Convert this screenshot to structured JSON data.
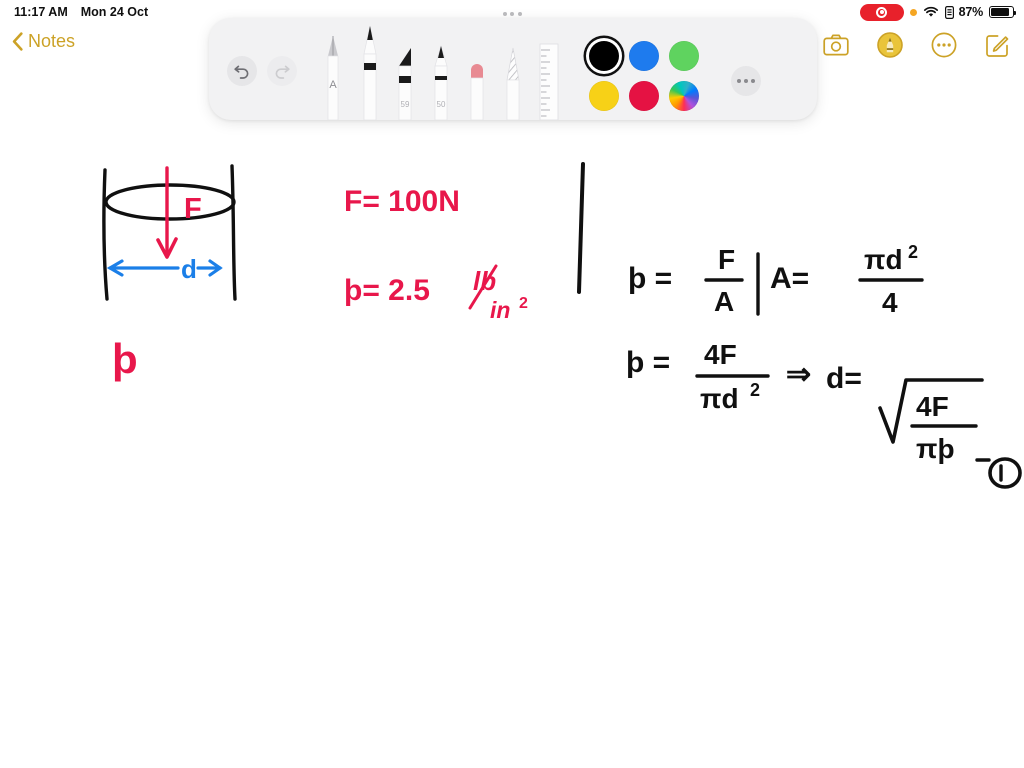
{
  "status_bar": {
    "time": "11:17 AM",
    "date": "Mon 24 Oct",
    "battery_percent": "87%",
    "icons": {
      "recording": "screen-recording-pill-icon",
      "orange_dot": "microphone-in-use-indicator-icon",
      "wifi": "wifi-icon",
      "lock": "orientation-lock-icon",
      "battery": "battery-icon"
    },
    "colors": {
      "recording_red": "#E8212B",
      "orange": "#F5A623",
      "text": "#101010"
    }
  },
  "navbar": {
    "back_label": "Notes",
    "back_icon": "chevron-left-icon",
    "accent_color": "#CCA227",
    "actions": [
      {
        "name": "camera-button",
        "icon": "camera-icon"
      },
      {
        "name": "markup-button",
        "icon": "markup-pen-circle-icon"
      },
      {
        "name": "more-options-button",
        "icon": "ellipsis-circle-icon"
      },
      {
        "name": "compose-button",
        "icon": "compose-square-pencil-icon"
      }
    ]
  },
  "tool_palette": {
    "handle": "drag-handle-icon",
    "undo": {
      "label": "Undo",
      "icon": "undo-arrow-icon",
      "enabled": true
    },
    "redo": {
      "label": "Redo",
      "icon": "redo-arrow-icon",
      "enabled": false
    },
    "tools": [
      {
        "name": "scribble-tool",
        "label": "A",
        "selected": false
      },
      {
        "name": "pen-tool",
        "label": "",
        "selected": true
      },
      {
        "name": "highlighter-tool",
        "label": "59",
        "selected": false
      },
      {
        "name": "marker-tool",
        "label": "50",
        "selected": false
      },
      {
        "name": "eraser-tool",
        "label": "",
        "selected": false
      },
      {
        "name": "lasso-select-tool",
        "label": "",
        "selected": false
      },
      {
        "name": "ruler-tool",
        "label": "",
        "selected": false
      }
    ],
    "colors": [
      {
        "name": "color-black",
        "hex": "#000000",
        "selected": true
      },
      {
        "name": "color-blue",
        "hex": "#1E7BEE",
        "selected": false
      },
      {
        "name": "color-green",
        "hex": "#5FD35F",
        "selected": false
      },
      {
        "name": "color-yellow",
        "hex": "#F7D117",
        "selected": false
      },
      {
        "name": "color-red",
        "hex": "#E51243",
        "selected": false
      },
      {
        "name": "color-picker",
        "hex": "rainbow",
        "selected": false
      }
    ],
    "more_label": "•••",
    "background": "#F2F2F3"
  },
  "canvas": {
    "ink_colors": {
      "black": "#101010",
      "red": "#E8174B",
      "blue": "#1B7FE8"
    },
    "diagram": {
      "name": "cylinder-force-diagram",
      "force_label": "F",
      "diameter_label": "d",
      "pressure_label": "p"
    },
    "notes": [
      {
        "name": "given-force",
        "text": "F = 100N",
        "color": "#E8174B"
      },
      {
        "name": "given-pressure",
        "text": "p = 2.5 lb/in²",
        "color": "#E8174B"
      },
      {
        "name": "pressure-formula",
        "text": "p = F / A",
        "color": "#101010"
      },
      {
        "name": "area-formula",
        "text": "A = πd² / 4",
        "color": "#101010"
      },
      {
        "name": "derived-pressure",
        "text": "p = 4F / πd²",
        "color": "#101010"
      },
      {
        "name": "implies-symbol",
        "text": "⇒",
        "color": "#101010"
      },
      {
        "name": "diameter-solution",
        "text": "d = √(4F / πp)",
        "color": "#101010"
      },
      {
        "name": "equation-number",
        "text": "1",
        "color": "#101010"
      }
    ]
  }
}
